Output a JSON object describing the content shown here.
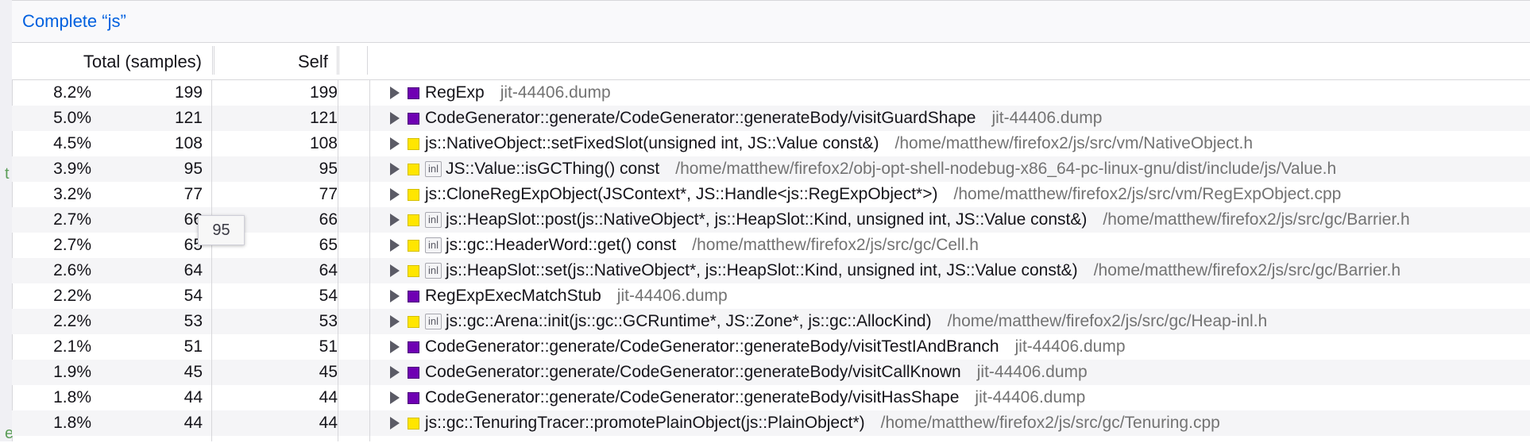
{
  "breadcrumb": "Complete “js”",
  "columns": {
    "total": "Total (samples)",
    "self": "Self"
  },
  "tooltip": "95",
  "rows": [
    {
      "pct": "8.2%",
      "total": "199",
      "self": "199",
      "kind": "jit",
      "inl": false,
      "name": "RegExp",
      "origin": "jit-44406.dump"
    },
    {
      "pct": "5.0%",
      "total": "121",
      "self": "121",
      "kind": "jit",
      "inl": false,
      "name": "CodeGenerator::generate/CodeGenerator::generateBody/visitGuardShape",
      "origin": "jit-44406.dump"
    },
    {
      "pct": "4.5%",
      "total": "108",
      "self": "108",
      "kind": "cpp",
      "inl": false,
      "name": "js::NativeObject::setFixedSlot(unsigned int, JS::Value const&)",
      "origin": "/home/matthew/firefox2/js/src/vm/NativeObject.h"
    },
    {
      "pct": "3.9%",
      "total": "95",
      "self": "95",
      "kind": "cpp",
      "inl": true,
      "name": "JS::Value::isGCThing() const",
      "origin": "/home/matthew/firefox2/obj-opt-shell-nodebug-x86_64-pc-linux-gnu/dist/include/js/Value.h"
    },
    {
      "pct": "3.2%",
      "total": "77",
      "self": "77",
      "kind": "cpp",
      "inl": false,
      "name": "js::CloneRegExpObject(JSContext*, JS::Handle<js::RegExpObject*>)",
      "origin": "/home/matthew/firefox2/js/src/vm/RegExpObject.cpp"
    },
    {
      "pct": "2.7%",
      "total": "66",
      "self": "66",
      "kind": "cpp",
      "inl": true,
      "name": "js::HeapSlot::post(js::NativeObject*, js::HeapSlot::Kind, unsigned int, JS::Value const&)",
      "origin": "/home/matthew/firefox2/js/src/gc/Barrier.h"
    },
    {
      "pct": "2.7%",
      "total": "65",
      "self": "65",
      "kind": "cpp",
      "inl": true,
      "name": "js::gc::HeaderWord::get() const",
      "origin": "/home/matthew/firefox2/js/src/gc/Cell.h"
    },
    {
      "pct": "2.6%",
      "total": "64",
      "self": "64",
      "kind": "cpp",
      "inl": true,
      "name": "js::HeapSlot::set(js::NativeObject*, js::HeapSlot::Kind, unsigned int, JS::Value const&)",
      "origin": "/home/matthew/firefox2/js/src/gc/Barrier.h"
    },
    {
      "pct": "2.2%",
      "total": "54",
      "self": "54",
      "kind": "jit",
      "inl": false,
      "name": "RegExpExecMatchStub",
      "origin": "jit-44406.dump"
    },
    {
      "pct": "2.2%",
      "total": "53",
      "self": "53",
      "kind": "cpp",
      "inl": true,
      "name": "js::gc::Arena::init(js::gc::GCRuntime*, JS::Zone*, js::gc::AllocKind)",
      "origin": "/home/matthew/firefox2/js/src/gc/Heap-inl.h"
    },
    {
      "pct": "2.1%",
      "total": "51",
      "self": "51",
      "kind": "jit",
      "inl": false,
      "name": "CodeGenerator::generate/CodeGenerator::generateBody/visitTestIAndBranch",
      "origin": "jit-44406.dump"
    },
    {
      "pct": "1.9%",
      "total": "45",
      "self": "45",
      "kind": "jit",
      "inl": false,
      "name": "CodeGenerator::generate/CodeGenerator::generateBody/visitCallKnown",
      "origin": "jit-44406.dump"
    },
    {
      "pct": "1.8%",
      "total": "44",
      "self": "44",
      "kind": "jit",
      "inl": false,
      "name": "CodeGenerator::generate/CodeGenerator::generateBody/visitHasShape",
      "origin": "jit-44406.dump"
    },
    {
      "pct": "1.8%",
      "total": "44",
      "self": "44",
      "kind": "cpp",
      "inl": false,
      "name": "js::gc::TenuringTracer::promotePlainObject(js::PlainObject*)",
      "origin": "/home/matthew/firefox2/js/src/gc/Tenuring.cpp"
    }
  ],
  "inl_label": "inl",
  "colors": {
    "jit": "#6f00b3",
    "cpp": "#ffe600",
    "link": "#0060df"
  }
}
